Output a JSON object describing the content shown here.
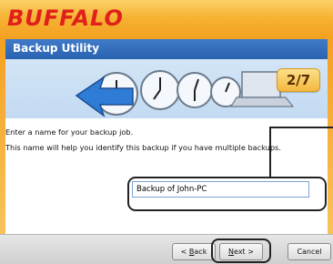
{
  "brand": {
    "logo_text": "BUFFALO",
    "accent": "#e0201a",
    "frame_color": "#f4a020"
  },
  "window": {
    "title": "Backup Utility",
    "step": "2/7"
  },
  "content": {
    "instruction_line1": "Enter a name for your backup job.",
    "instruction_line2": "This name will help you identify this backup if you have multiple backups.",
    "backup_name_value": "Backup of John-PC"
  },
  "footer": {
    "back_label_prefix": "< ",
    "back_label_accel": "B",
    "back_label_rest": "ack",
    "next_label_accel": "N",
    "next_label_rest": "ext >",
    "cancel_label": "Cancel"
  },
  "icons": {
    "illustration": "clocks-laptop-arrow-icon"
  }
}
